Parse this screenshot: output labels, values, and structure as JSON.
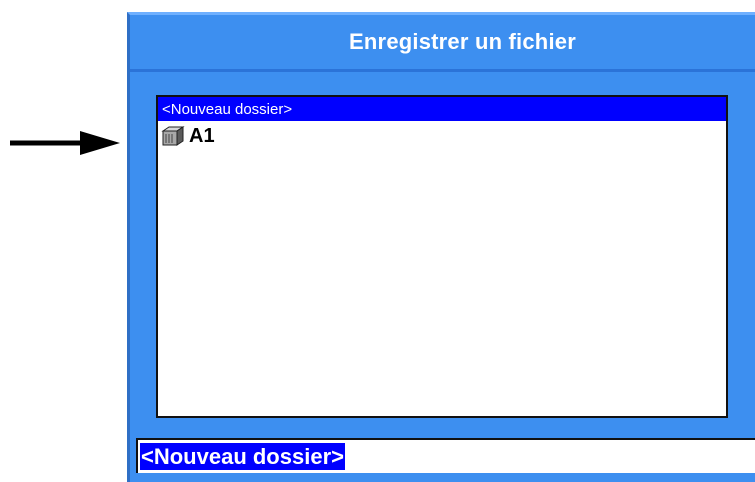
{
  "dialog": {
    "title": "Enregistrer un fichier",
    "list_items": [
      {
        "label": "<Nouveau dossier>",
        "type": "new-folder",
        "selected": true
      },
      {
        "label": "A1",
        "type": "folder",
        "icon": "folder-icon",
        "selected": false
      }
    ],
    "name_field_value": "<Nouveau dossier>"
  },
  "annotation": {
    "icon": "arrow-right-icon"
  },
  "colors": {
    "dialog_background": "#3d8ff0",
    "selection": "#0000ff",
    "title_text": "#ffffff"
  }
}
